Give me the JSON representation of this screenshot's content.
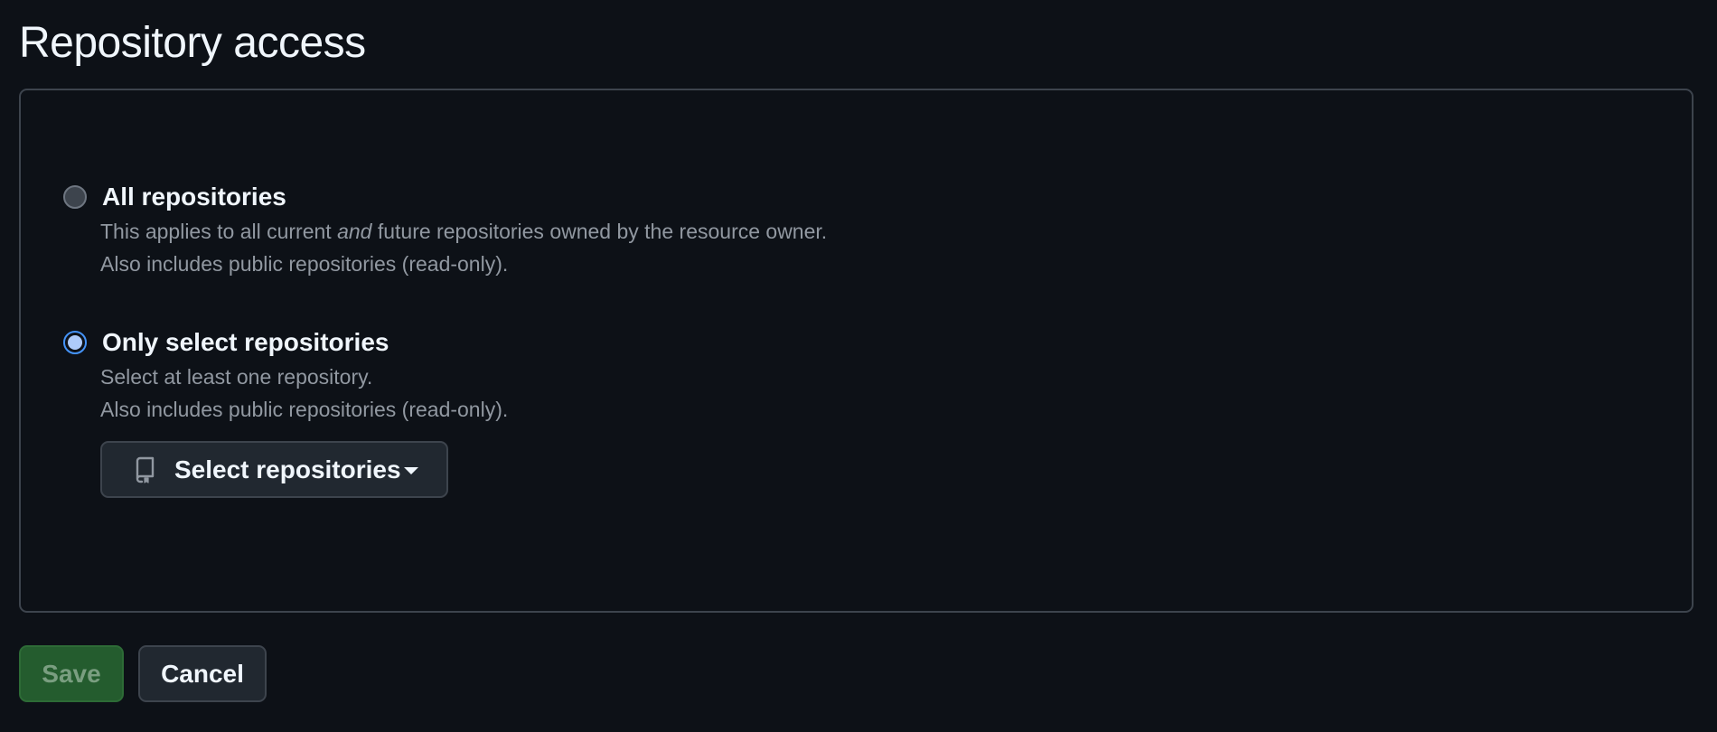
{
  "page": {
    "title": "Repository access"
  },
  "options": {
    "all": {
      "label": "All repositories",
      "desc_prefix": "This applies to all current ",
      "desc_emphasis": "and",
      "desc_suffix": " future repositories owned by the resource owner.",
      "note": "Also includes public repositories (read-only).",
      "selected": false
    },
    "select": {
      "label": "Only select repositories",
      "desc": "Select at least one repository.",
      "note": "Also includes public repositories (read-only).",
      "selected": true
    }
  },
  "select_button": {
    "label": "Select repositories",
    "icon": "repo-icon"
  },
  "actions": {
    "save_label": "Save",
    "save_enabled": false,
    "cancel_label": "Cancel"
  },
  "colors": {
    "background": "#0d1117",
    "accent": "#4493f8",
    "save_disabled_bg": "#245c2e"
  }
}
